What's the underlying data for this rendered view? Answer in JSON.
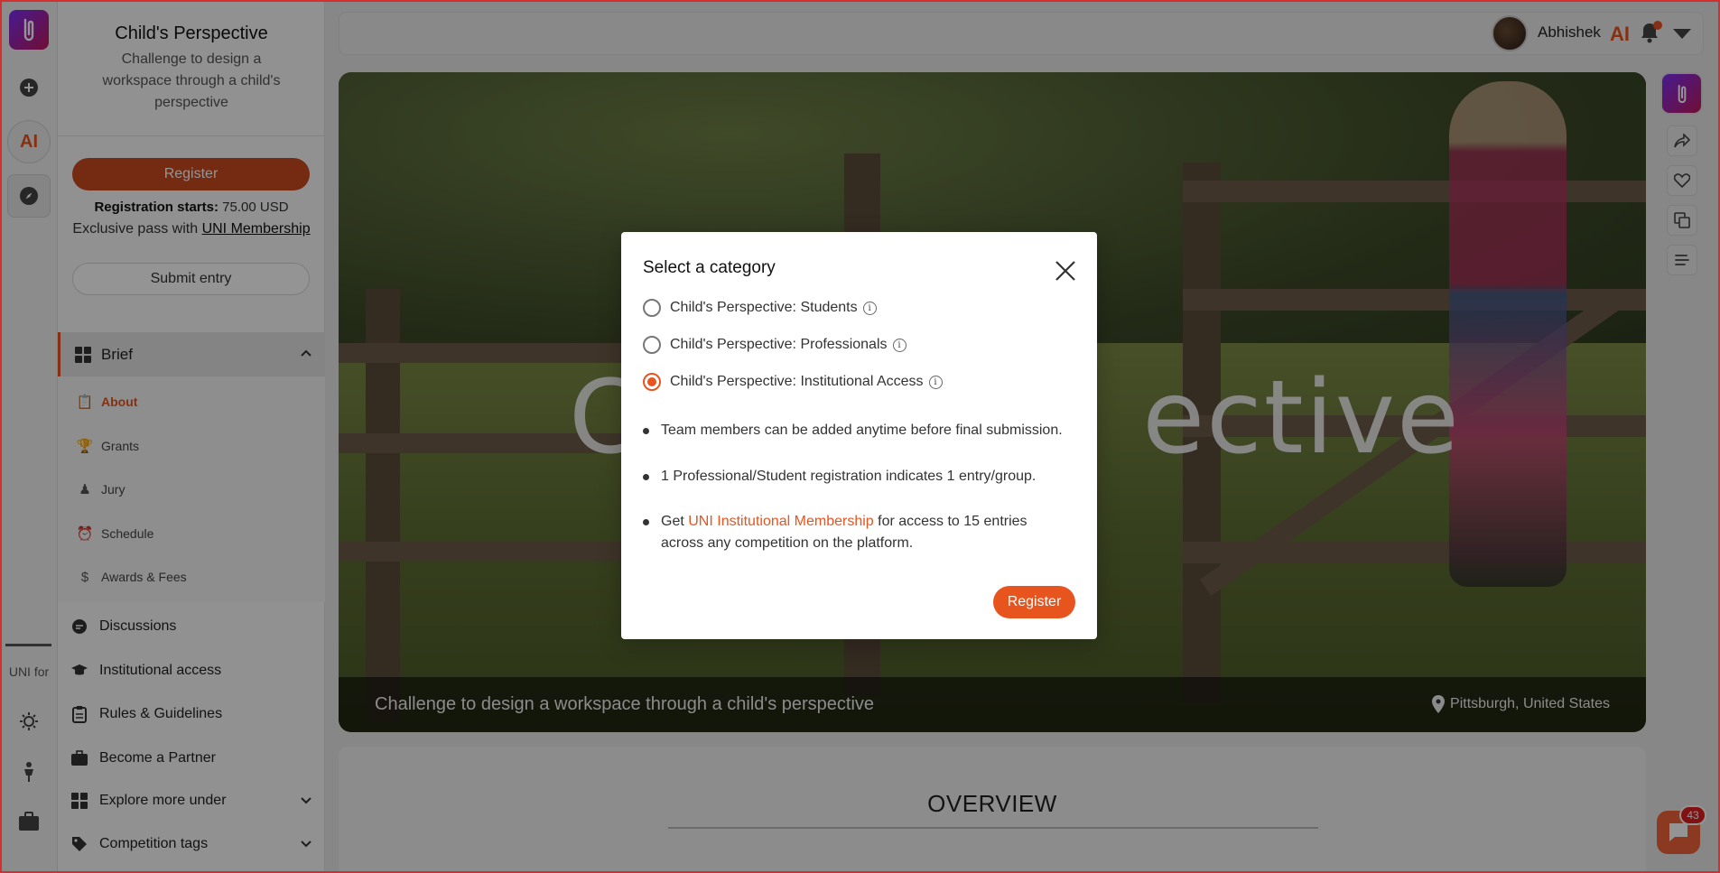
{
  "sidebar": {
    "title": "Child's Perspective",
    "subtitle": "Challenge to design a workspace through a child's perspective",
    "register_label": "Register",
    "registration_label": "Registration starts:",
    "registration_price": "75.00 USD",
    "exclusive_text": "Exclusive pass with",
    "membership_link": "UNI Membership",
    "submit_label": "Submit entry",
    "brief_label": "Brief",
    "brief_items": [
      {
        "label": "About",
        "icon": "clipboard-icon",
        "active": true
      },
      {
        "label": "Grants",
        "icon": "trophy-icon"
      },
      {
        "label": "Jury",
        "icon": "person-icon"
      },
      {
        "label": "Schedule",
        "icon": "clock-icon"
      },
      {
        "label": "Awards & Fees",
        "icon": "dollar-icon"
      }
    ],
    "menu": [
      {
        "label": "Discussions",
        "icon": "chat-icon"
      },
      {
        "label": "Institutional access",
        "icon": "graduation-cap-icon"
      },
      {
        "label": "Rules & Guidelines",
        "icon": "clipboard-icon"
      },
      {
        "label": "Become a Partner",
        "icon": "briefcase-icon"
      },
      {
        "label": "Explore more under",
        "icon": "grid-icon"
      },
      {
        "label": "Competition tags",
        "icon": "tag-icon"
      }
    ]
  },
  "rail": {
    "ai_label": "AI",
    "uni_label": "UNI for"
  },
  "topbar": {
    "user_name": "Abhishek",
    "ai_label": "AI"
  },
  "hero": {
    "title_fragment_left": "C",
    "title_fragment_right": "ective",
    "caption": "Challenge to design a workspace through a child's perspective",
    "location": "Pittsburgh, United States"
  },
  "overview": {
    "title": "OVERVIEW"
  },
  "chat": {
    "badge_count": "43"
  },
  "modal": {
    "title": "Select a category",
    "options": [
      {
        "label": "Child's Perspective: Students",
        "selected": false
      },
      {
        "label": "Child's Perspective: Professionals",
        "selected": false
      },
      {
        "label": "Child's Perspective: Institutional Access",
        "selected": true
      }
    ],
    "bullets": {
      "b1": "Team members can be added anytime before final submission.",
      "b2": "1 Professional/Student registration indicates 1 entry/group.",
      "b3_prefix": "Get",
      "b3_link": "UNI Institutional Membership",
      "b3_suffix": "for access to 15 entries across any competition on the platform."
    },
    "register_label": "Register"
  },
  "colors": {
    "accent": "#e8541e",
    "register_dark": "#c84a1e",
    "badge": "#e02020"
  }
}
